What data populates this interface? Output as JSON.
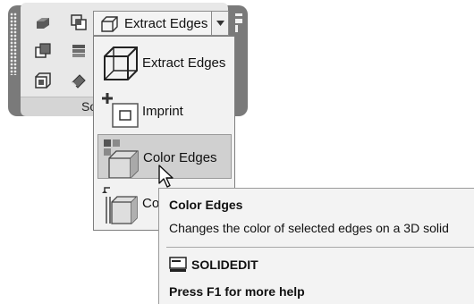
{
  "ribbon": {
    "panel_label": "So",
    "split_button_label": "Extract Edges",
    "pin_glyph": "⌁"
  },
  "dropdown": {
    "items": [
      {
        "label": "Extract Edges",
        "icon": "wireframe-box-icon"
      },
      {
        "label": "Imprint",
        "icon": "imprint-icon"
      },
      {
        "label": "Color Edges",
        "icon": "color-edges-icon",
        "highlighted": true
      },
      {
        "label": "Co",
        "icon": "copy-edges-icon"
      }
    ]
  },
  "tooltip": {
    "title": "Color Edges",
    "description": "Changes the color of selected edges on a 3D solid",
    "command": "SOLIDEDIT",
    "help": "Press F1 for more help"
  }
}
